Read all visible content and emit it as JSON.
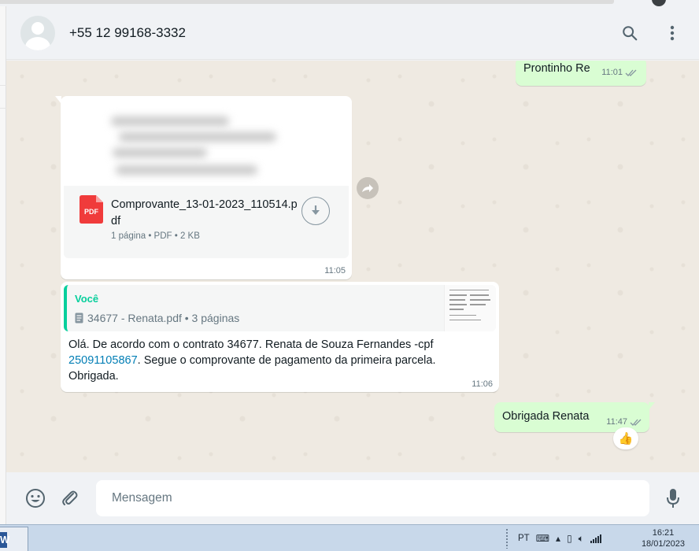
{
  "header": {
    "contact_name": "+55 12 99168-3332",
    "search_icon": "search-icon",
    "menu_icon": "vertical-dots-icon"
  },
  "messages": [
    {
      "direction": "out",
      "text": "Prontinho Re",
      "time": "11:01",
      "status": "read"
    },
    {
      "direction": "in",
      "type": "document",
      "file_name": "Comprovante_13-01-2023_110514.pdf",
      "file_badge": "PDF",
      "details": "1 página • PDF • 2 KB",
      "time": "11:05"
    },
    {
      "direction": "in",
      "type": "reply",
      "quote_author": "Você",
      "quote_text": "34677 - Renata.pdf • 3 páginas",
      "text_before_link": "Olá. De acordo com o contrato 34677. Renata de Souza Fernandes -cpf ",
      "link_text": "25091105867",
      "text_after_link": ". Segue o comprovante de pagamento da primeira parcela. Obrigada.",
      "time": "11:06"
    },
    {
      "direction": "out",
      "text": "Obrigada Renata",
      "time": "11:47",
      "status": "read",
      "reaction": "👍"
    }
  ],
  "composer": {
    "placeholder": "Mensagem",
    "emoji_icon": "emoji-icon",
    "attach_icon": "paperclip-icon",
    "mic_icon": "microphone-icon"
  },
  "taskbar": {
    "app_letter": "W",
    "language": "PT",
    "time": "16:21",
    "date": "18/01/2023"
  },
  "colors": {
    "outgoing_bubble": "#d9fdd3",
    "incoming_bubble": "#ffffff",
    "accent": "#06cf9c",
    "link": "#027eb5",
    "chat_bg": "#efeae2",
    "read_ticks": "#53bdeb"
  }
}
